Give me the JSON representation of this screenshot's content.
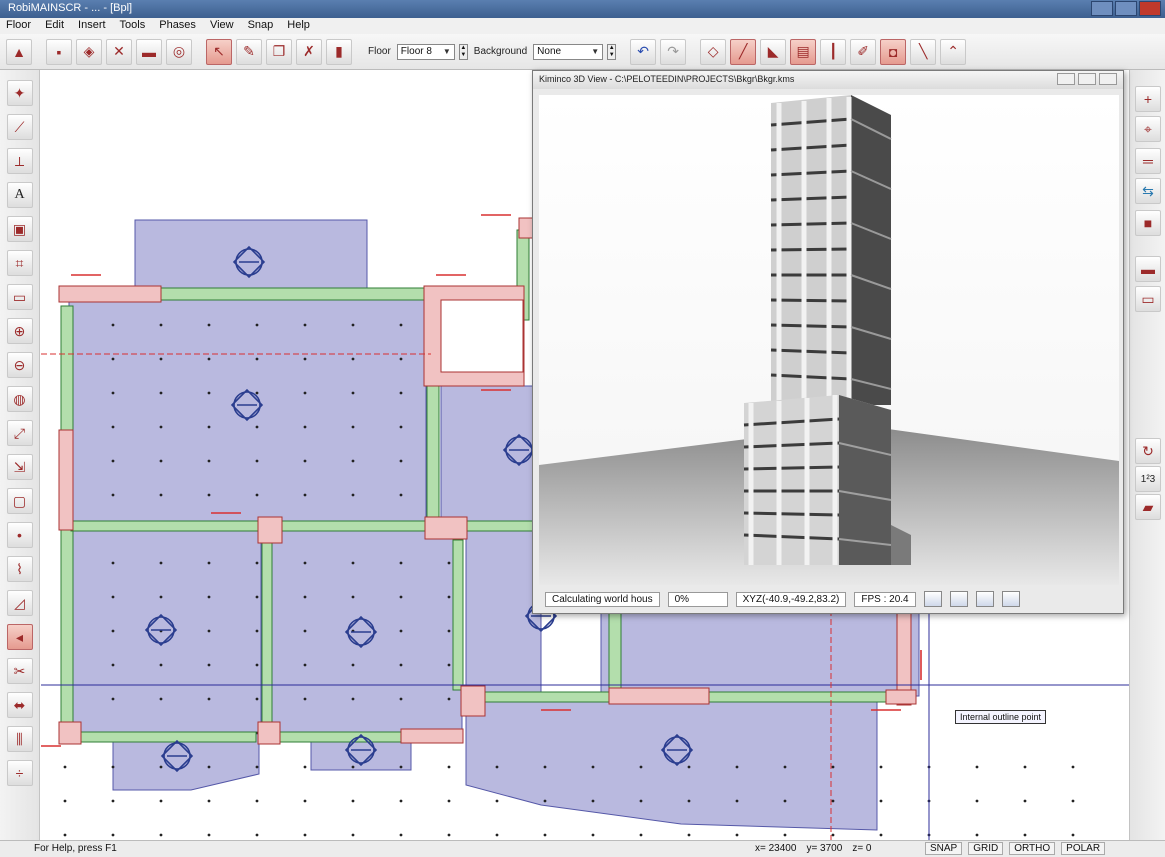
{
  "window": {
    "title": "RobiMAINSCR - ... - [Bpl]"
  },
  "menu": [
    "Floor",
    "Edit",
    "Insert",
    "Tools",
    "Phases",
    "View",
    "Snap",
    "Help"
  ],
  "toolbar": {
    "floor_label": "Floor",
    "floor_value": "Floor 8",
    "background_label": "Background",
    "background_value": "None"
  },
  "view3d": {
    "title": "Kiminco 3D View - C:\\PELOTEEDIN\\PROJECTS\\Bkgr\\Bkgr.kms",
    "status_text": "Calculating world hous",
    "percent": "0%",
    "coords": "XYZ(-40.9,-49.2,83.2)",
    "fps": "FPS : 20.4"
  },
  "tooltip": "Internal outline point",
  "status": {
    "help": "For Help, press F1",
    "x": "x= 23400",
    "y": "y= 3700",
    "z": "z= 0",
    "modes": [
      "SNAP",
      "GRID",
      "ORTHO",
      "POLAR"
    ]
  },
  "colors": {
    "slab": "#b9b9df",
    "beam": "#b3deac",
    "column": "#f1c2c2",
    "accent_red": "#d93030"
  }
}
